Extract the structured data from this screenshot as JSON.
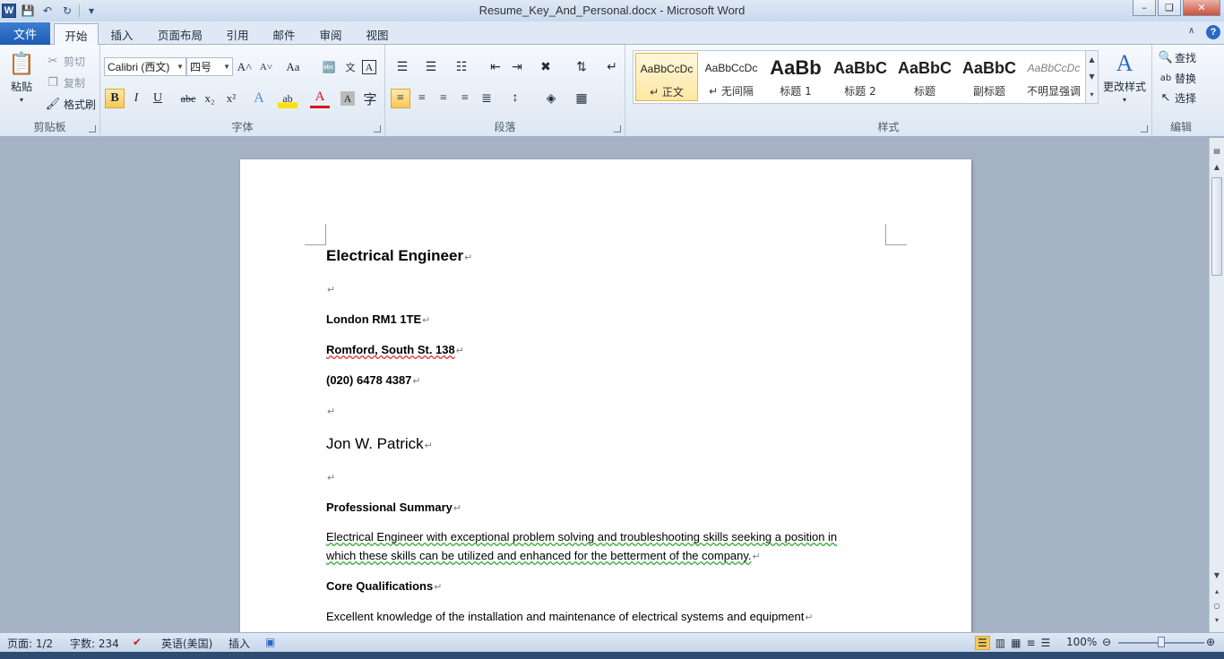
{
  "window": {
    "title": "Resume_Key_And_Personal.docx - Microsoft Word",
    "app_icon": "W",
    "quick_access": [
      "save-icon",
      "undo-icon",
      "redo-icon",
      "customize-icon"
    ],
    "controls": [
      "minimize-icon",
      "maximize-icon",
      "close-icon"
    ]
  },
  "tabs": {
    "file": "文件",
    "items": [
      "开始",
      "插入",
      "页面布局",
      "引用",
      "邮件",
      "审阅",
      "视图"
    ],
    "active": "开始",
    "help": "?"
  },
  "ribbon": {
    "clipboard": {
      "label": "剪贴板",
      "paste": "粘贴",
      "cut": "剪切",
      "copy": "复制",
      "format_painter": "格式刷"
    },
    "font": {
      "label": "字体",
      "font_name": "Calibri (西文)",
      "font_size": "四号",
      "grow": "A˄",
      "shrink": "A˅",
      "change_case": "Aa",
      "bold": "B",
      "italic": "I",
      "underline": "U",
      "strike": "abc",
      "subscript": "x₂",
      "superscript": "x²"
    },
    "paragraph": {
      "label": "段落"
    },
    "styles": {
      "label": "样式",
      "items": [
        {
          "sample": "AaBbCcDc",
          "name": "↵ 正文",
          "selected": true
        },
        {
          "sample": "AaBbCcDc",
          "name": "↵ 无间隔",
          "selected": false
        },
        {
          "sample": "AaBb",
          "name": "标题 1",
          "selected": false
        },
        {
          "sample": "AaBbC",
          "name": "标题 2",
          "selected": false
        },
        {
          "sample": "AaBbC",
          "name": "标题",
          "selected": false
        },
        {
          "sample": "AaBbC",
          "name": "副标题",
          "selected": false
        },
        {
          "sample": "AaBbCcDc",
          "name": "不明显强调",
          "selected": false
        }
      ],
      "change_styles": "更改样式"
    },
    "editing": {
      "label": "编辑",
      "find": "查找",
      "replace": "替换",
      "select": "选择"
    }
  },
  "document": {
    "paragraphs": [
      {
        "text": "Electrical Engineer",
        "style": "heading"
      },
      {
        "text": "",
        "style": "empty"
      },
      {
        "text": "London RM1 1TE",
        "style": "bold"
      },
      {
        "text": "Romford, South St. 138",
        "style": "bold"
      },
      {
        "text": "(020) 6478 4387",
        "style": "bold"
      },
      {
        "text": "",
        "style": "empty"
      },
      {
        "text": "Jon W. Patrick",
        "style": "name"
      },
      {
        "text": "",
        "style": "empty"
      },
      {
        "text": "Professional Summary",
        "style": "bold"
      },
      {
        "text": "Electrical Engineer with exceptional problem solving and troubleshooting skills seeking a position in",
        "style": "body"
      },
      {
        "text": "which these skills can be utilized and enhanced for the betterment of the company.",
        "style": "body"
      },
      {
        "text": "Core Qualifications",
        "style": "bold"
      },
      {
        "text": "Excellent knowledge of the installation and maintenance of electrical systems and equipment",
        "style": "body"
      }
    ],
    "para_mark": "↵"
  },
  "statusbar": {
    "page": "页面: 1/2",
    "words": "字数: 234",
    "language": "英语(美国)",
    "insert_mode": "插入",
    "zoom": "100%"
  }
}
